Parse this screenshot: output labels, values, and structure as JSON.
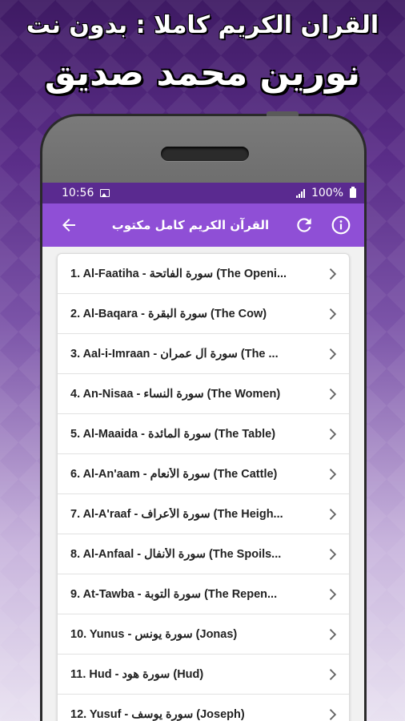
{
  "promo": {
    "line1": "القران الكريم كاملا : بدون نت",
    "line2": "نورين محمد صديق"
  },
  "status": {
    "time": "10:56",
    "battery": "100%"
  },
  "toolbar": {
    "title": "القرآن الكريم كامل مكتوب",
    "back_icon": "arrow-left-icon",
    "refresh_icon": "refresh-icon",
    "info_icon": "info-icon"
  },
  "colors": {
    "statusbar": "#5a2a90",
    "toolbar": "#8f4fd6",
    "chevron": "#666666"
  },
  "surahs": [
    "1. Al-Faatiha - سورة الفاتحة (The Openi...",
    "2. Al-Baqara - سورة البقرة (The Cow)",
    "3. Aal-i-Imraan - سورة آل عمران (The ...",
    "4. An-Nisaa - سورة النساء (The Women)",
    "5. Al-Maaida - سورة المائدة (The Table)",
    "6. Al-An'aam - سورة الأنعام (The Cattle)",
    "7. Al-A'raaf - سورة الأعراف (The Heigh...",
    "8. Al-Anfaal - سورة الأنفال (The Spoils...",
    "9. At-Tawba - سورة التوبة (The Repen...",
    "10. Yunus - سورة يونس (Jonas)",
    "11. Hud - سورة هود (Hud)",
    "12. Yusuf - سورة يوسف (Joseph)"
  ]
}
